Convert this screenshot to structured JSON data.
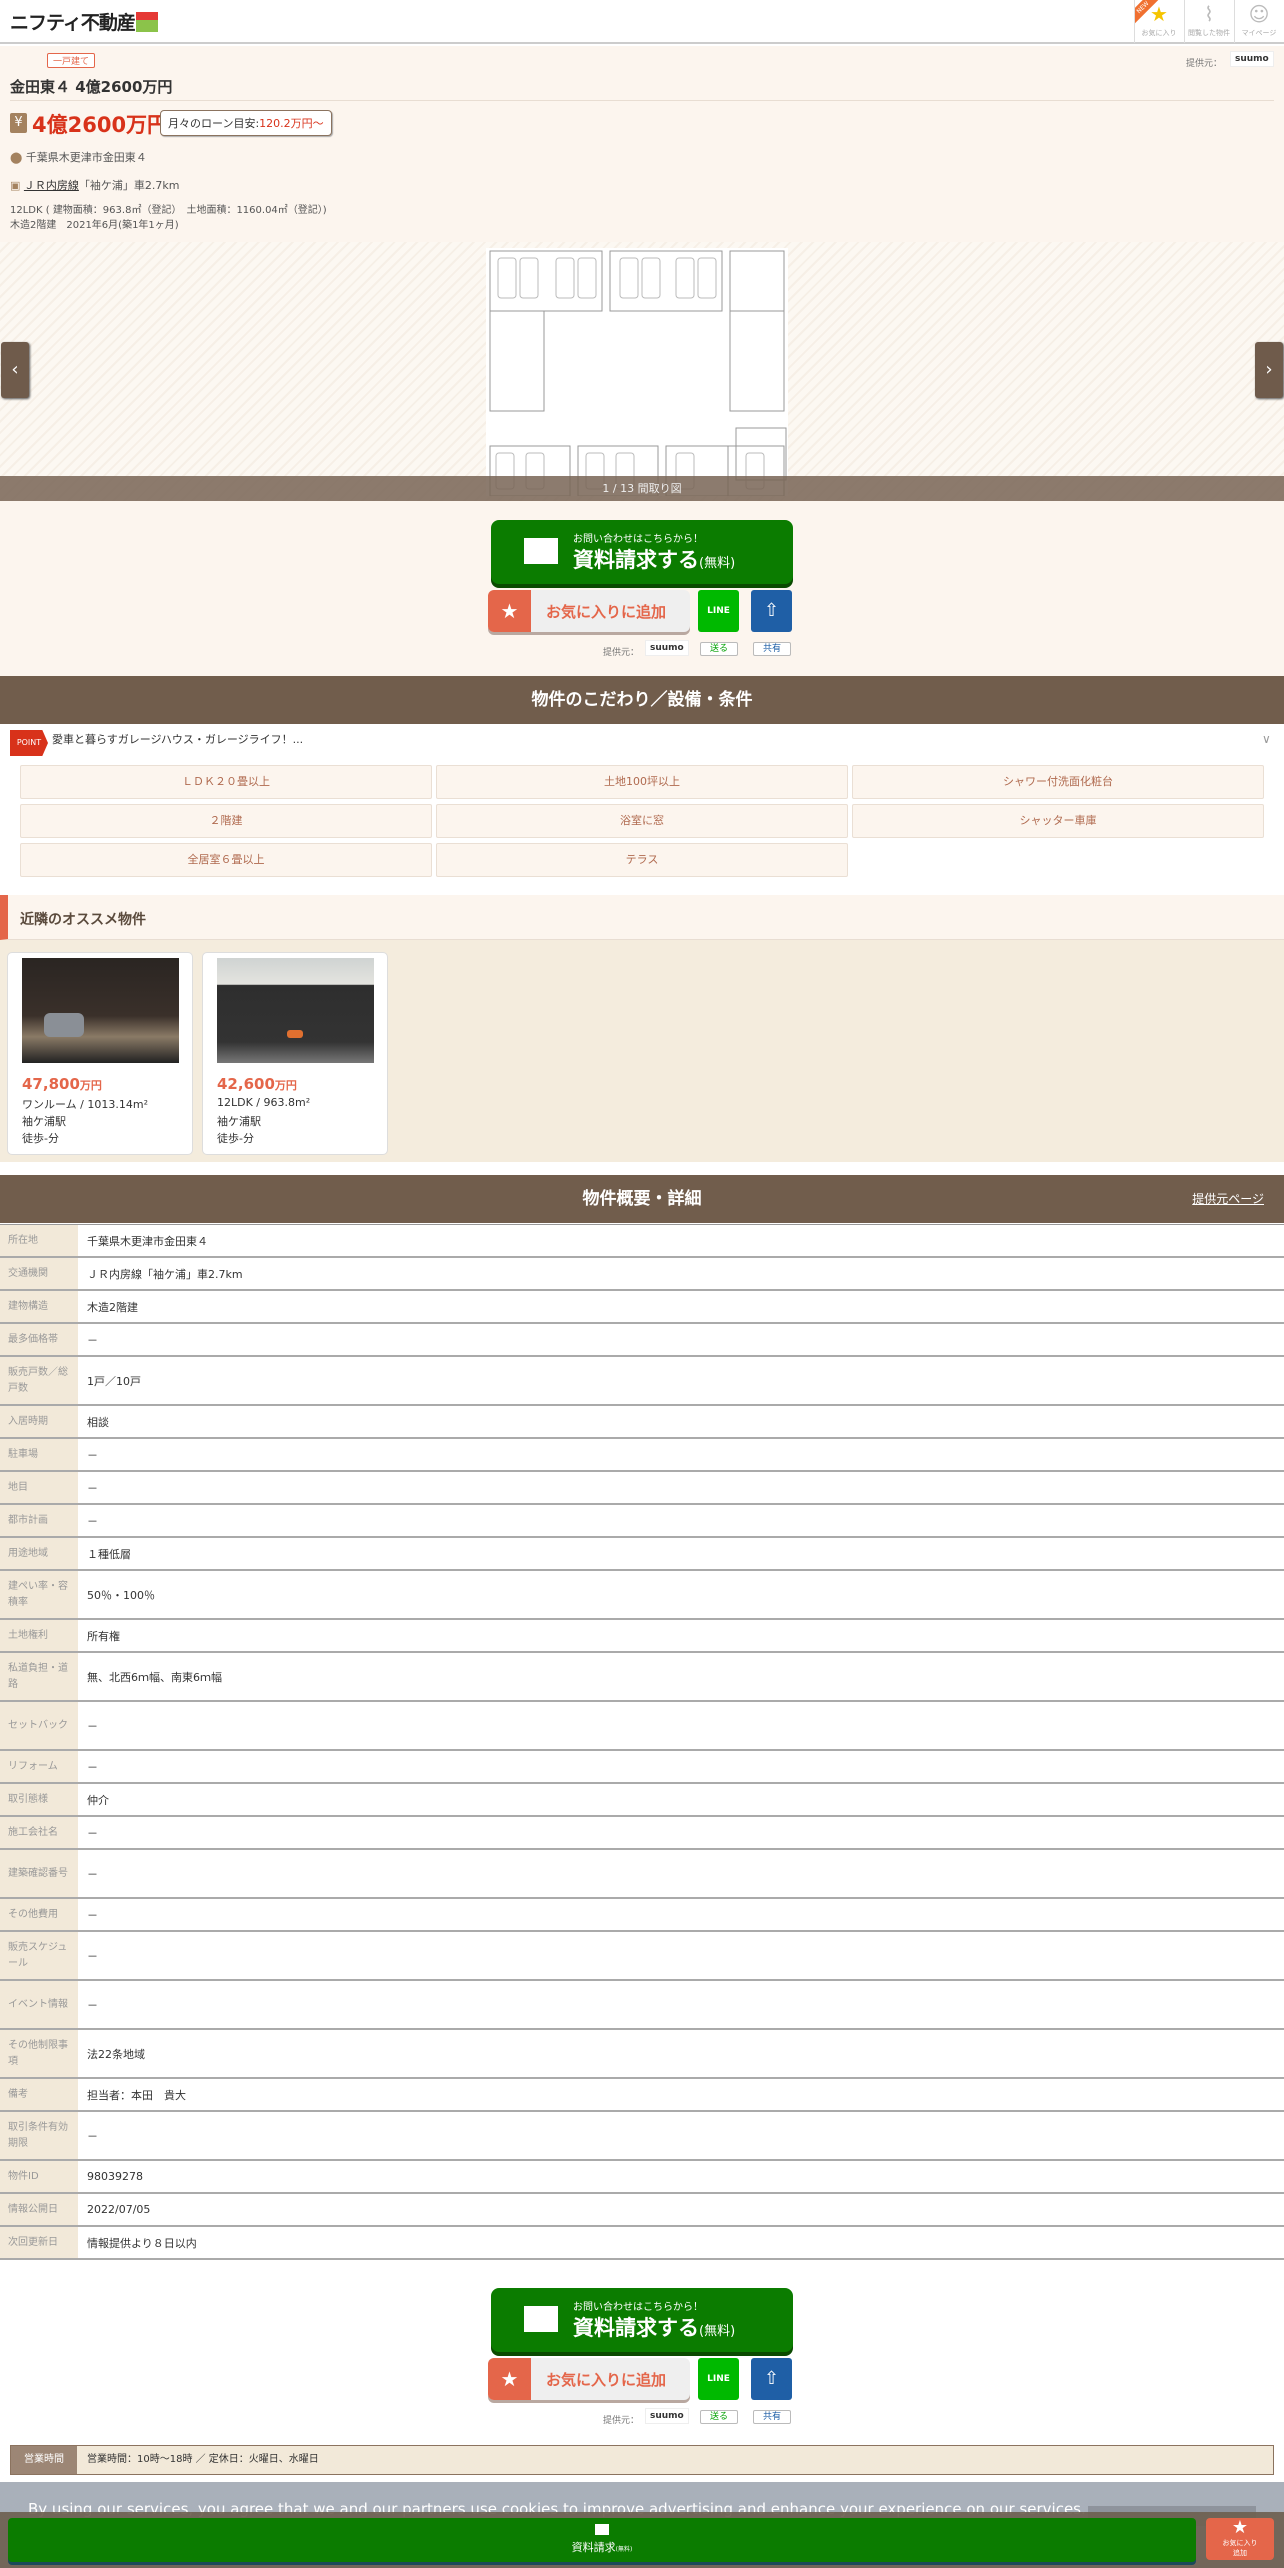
{
  "header": {
    "logo": "ニフティ不動産",
    "icons": [
      {
        "label": "お気に入り",
        "badge": "NEW"
      },
      {
        "label": "閲覧した物件"
      },
      {
        "label": "マイページ"
      }
    ]
  },
  "property": {
    "type_tag": "一戸建て",
    "provider_label": "提供元：",
    "provider": "suumo",
    "title": "金田東４ 4億2600万円",
    "price": "4億2600万円",
    "loan_label": "月々のローン目安:",
    "loan_value": "120.2万円～",
    "address": "千葉県木更津市金田東４",
    "station_link": "ＪＲ内房線",
    "station_rest": "「袖ケ浦」車2.7km",
    "specs1": "12LDK ( 建物面積：963.8㎡（登記）　土地面積：1160.04㎡（登記）)",
    "specs2": "木造2階建　2021年6月(築1年1ヶ月)"
  },
  "gallery": {
    "caption": "1 / 13 間取り図",
    "prev": "‹",
    "next": "›"
  },
  "actions": {
    "inquiry_sub": "お問い合わせはこちらから！",
    "inquiry_main": "資料請求する",
    "inquiry_free": "(無料)",
    "favorite": "お気に入りに追加",
    "line": "LINE",
    "line_label": "送る",
    "share_label": "共有",
    "provider_label": "提供元：",
    "provider": "suumo"
  },
  "features": {
    "heading": "物件のこだわり／設備・条件",
    "point_badge": "POINT",
    "point_text": "愛車と暮らすガレージハウス・ガレージライフ！...",
    "tags": [
      "ＬＤＫ２０畳以上",
      "土地100坪以上",
      "シャワー付洗面化粧台",
      "２階建",
      "浴室に窓",
      "シャッター車庫",
      "全居室６畳以上",
      "テラス"
    ]
  },
  "nearby": {
    "heading": "近隣のオススメ物件",
    "items": [
      {
        "price": "47,800",
        "unit": "万円",
        "layout": "ワンルーム / 1013.14m²",
        "station": "袖ケ浦駅",
        "walk": "徒歩-分"
      },
      {
        "price": "42,600",
        "unit": "万円",
        "layout": "12LDK / 963.8m²",
        "station": "袖ケ浦駅",
        "walk": "徒歩-分"
      }
    ]
  },
  "details": {
    "heading": "物件概要・詳細",
    "source_link": "提供元ページ",
    "rows": [
      {
        "k": "所在地",
        "v": "千葉県木更津市金田東４"
      },
      {
        "k": "交通機関",
        "v": "ＪＲ内房線「袖ケ浦」車2.7km"
      },
      {
        "k": "建物構造",
        "v": "木造2階建"
      },
      {
        "k": "最多価格帯",
        "v": "－"
      },
      {
        "k": "販売戸数／総戸数",
        "v": "1戸／10戸"
      },
      {
        "k": "入居時期",
        "v": "相談"
      },
      {
        "k": "駐車場",
        "v": "－"
      },
      {
        "k": "地目",
        "v": "－"
      },
      {
        "k": "都市計画",
        "v": "－"
      },
      {
        "k": "用途地域",
        "v": "１種低層"
      },
      {
        "k": "建ぺい率・容積率",
        "v": "50％・100％"
      },
      {
        "k": "土地権利",
        "v": "所有権"
      },
      {
        "k": "私道負担・道路",
        "v": "無、北西6ｍ幅、南東6ｍ幅"
      },
      {
        "k": "セットバック",
        "v": "－"
      },
      {
        "k": "リフォーム",
        "v": "－"
      },
      {
        "k": "取引態様",
        "v": "仲介"
      },
      {
        "k": "施工会社名",
        "v": "－"
      },
      {
        "k": "建築確認番号",
        "v": "－"
      },
      {
        "k": "その他費用",
        "v": "－"
      },
      {
        "k": "販売スケジュール",
        "v": "－"
      },
      {
        "k": "イベント情報",
        "v": "－"
      },
      {
        "k": "その他制限事項",
        "v": "法22条地域"
      },
      {
        "k": "備考",
        "v": "担当者：本田　貴大"
      },
      {
        "k": "取引条件有効期限",
        "v": "－"
      },
      {
        "k": "物件ID",
        "v": "98039278"
      },
      {
        "k": "情報公開日",
        "v": "2022/07/05"
      },
      {
        "k": "次回更新日",
        "v": "情報提供より８日以内"
      }
    ]
  },
  "hours": {
    "label": "営業時間",
    "value": "営業時間：10時～18時 ／ 定休日：火曜日、水曜日"
  },
  "cookie": {
    "text": "By using our services, you agree that we and our partners use cookies to improve advertising and enhance your experience on our services."
  },
  "bottom_bar": {
    "inquiry": "資料請求",
    "free": "(無料)",
    "fav1": "お気に入り",
    "fav2": "追加"
  }
}
